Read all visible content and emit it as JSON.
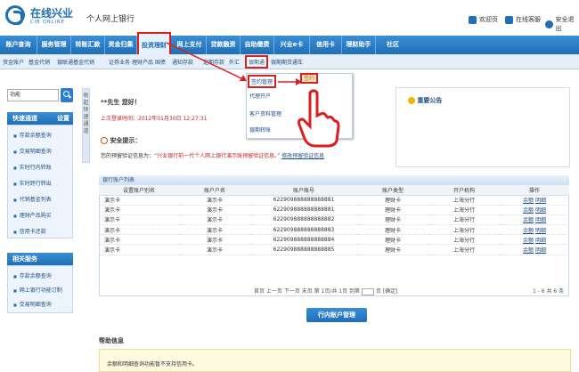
{
  "header": {
    "brand": "在线兴业",
    "brand_sub": "CIB ONLINE",
    "site_title": "个人网上银行",
    "links": [
      "欢迎页",
      "在线客服",
      "安全退出"
    ]
  },
  "main_nav": [
    "账户查询",
    "服务管理",
    "转账汇款",
    "资金归集",
    "投资理财",
    "网上支付",
    "贷款融资",
    "自助缴费",
    "兴业e卡",
    "信用卡",
    "理财助手",
    "社区"
  ],
  "main_nav_active": "投资理财",
  "sub_nav": [
    "资金账户",
    "基金代销",
    "银联通基金代销",
    "证券业务",
    "理财产品",
    "国债",
    "通知存款",
    "定期存款",
    "外汇",
    "银期通",
    "银期期货通车"
  ],
  "sub_nav_active": "银期通",
  "dropdown": {
    "items": [
      "签约管理",
      "代理开户",
      "客户资料管理",
      "银期转账"
    ],
    "active": "签约管理",
    "submenu": "签约"
  },
  "sidebar": {
    "search_value": "功能",
    "quick_title": "快速通道",
    "quick_settings": "设置",
    "quick_items": [
      "存款余额查询",
      "交易明细查询",
      "实时行内转账",
      "实时跨行转出",
      "代销基金列表",
      "理财产品购买",
      "信用卡还款"
    ],
    "related_title": "相关服务",
    "related_items": [
      "存款余额查询",
      "网上银行功能订制",
      "交易明细查询"
    ]
  },
  "collapse_text": "收起快速通道",
  "greeting": "**先生 您好！",
  "last_login": "上次登录时间：2012年01月30日 12:27:31",
  "tip_title": "安全提示：",
  "tip_prefix": "您的预留验证信息为：",
  "tip_red": "“兴业银行前一代个人网上银行演示账预留验证信息。”",
  "tip_link": "修改预留验证信息",
  "notice_title": "重要公告",
  "table": {
    "title": "银行账户列表",
    "headers": [
      "设置账户别名",
      "账户户名",
      "账户账号",
      "账户类型",
      "开户机构",
      "操作"
    ],
    "rows": [
      [
        "演示卡",
        "演示卡",
        "622909888888888881",
        "理财卡",
        "上海分行",
        "余额",
        "明细"
      ],
      [
        "演示卡",
        "演示卡",
        "622909888888888881",
        "理财卡",
        "上海分行",
        "余额",
        "明细"
      ],
      [
        "演示卡",
        "演示卡",
        "622909888888888882",
        "理财卡",
        "上海分行",
        "余额",
        "明细"
      ],
      [
        "演示卡",
        "演示卡",
        "622909888888888883",
        "理财卡",
        "上海分行",
        "余额",
        "明细"
      ],
      [
        "演示卡",
        "演示卡",
        "622909888888888884",
        "理财卡",
        "上海分行",
        "余额",
        "明细"
      ],
      [
        "演示卡",
        "演示卡",
        "622909888888888885",
        "理财卡",
        "上海分行",
        "余额",
        "明细"
      ]
    ]
  },
  "pager": {
    "text": "首页  上一页  下一页  末页  第 1页/共 1页  到第",
    "unit": "页 [确定]",
    "range": "1 - 6  共 6 条"
  },
  "mgmt_button": "行内账户管理",
  "help_title": "帮助信息",
  "help_text": "余额和明细查询功能暂不支持信用卡。",
  "colors": {
    "primary": "#1f6fb5",
    "highlight": "#d9201f"
  }
}
